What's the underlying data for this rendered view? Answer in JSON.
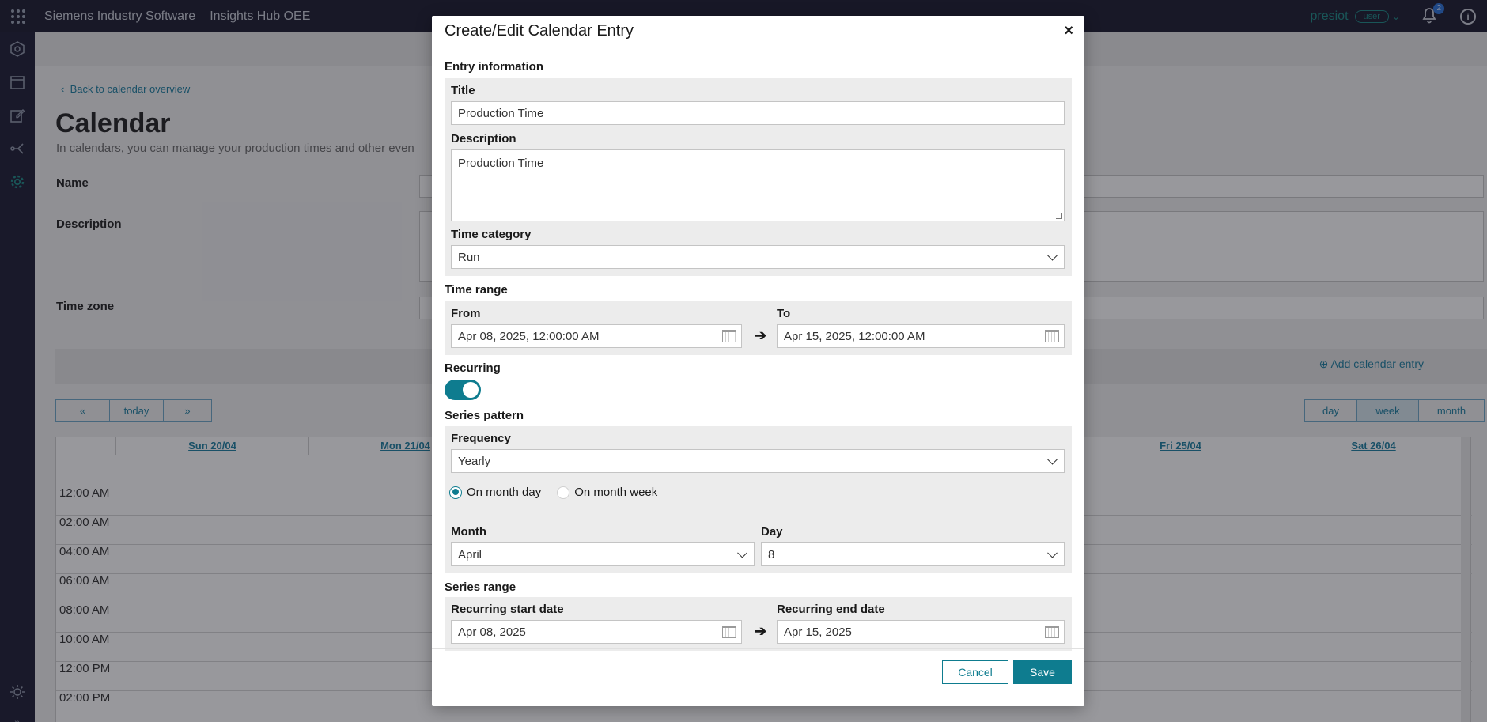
{
  "topbar": {
    "brand": "Siemens Industry Software",
    "app_name": "Insights Hub OEE",
    "tenant": "presiot",
    "user_role": "user",
    "notifications_count": "2",
    "info_symbol": "i"
  },
  "sidenav": {
    "items": [
      "insights-icon",
      "calendar-icon",
      "edit-icon",
      "share-icon",
      "settings-icon",
      "theme-icon",
      "expand-icon"
    ]
  },
  "page": {
    "back_link": "Back to calendar overview",
    "title": "Calendar",
    "subtitle": "In calendars, you can manage your production times and other even",
    "fields": {
      "name_label": "Name",
      "description_label": "Description",
      "timezone_label": "Time zone"
    },
    "add_entry": "Add calendar entry"
  },
  "calendar": {
    "nav": {
      "prev": "«",
      "today": "today",
      "next": "»"
    },
    "views": [
      "day",
      "week",
      "month"
    ],
    "active_view": "week",
    "days": [
      "Sun 20/04",
      "Mon 21/04",
      "Fri 25/04",
      "Sat 26/04"
    ],
    "hours": [
      "12:00 AM",
      "02:00 AM",
      "04:00 AM",
      "06:00 AM",
      "08:00 AM",
      "10:00 AM",
      "12:00 PM",
      "02:00 PM"
    ]
  },
  "modal": {
    "title": "Create/Edit Calendar Entry",
    "close_symbol": "×",
    "entry_info": {
      "section": "Entry information",
      "title_label": "Title",
      "title_value": "Production Time",
      "description_label": "Description",
      "description_value": "Production Time",
      "category_label": "Time category",
      "category_value": "Run"
    },
    "time_range": {
      "section": "Time range",
      "from_label": "From",
      "from_value": "Apr 08, 2025, 12:00:00 AM",
      "to_label": "To",
      "to_value": "Apr 15, 2025, 12:00:00 AM",
      "arrow": "➔"
    },
    "recurring": {
      "label": "Recurring",
      "enabled": true
    },
    "series_pattern": {
      "section": "Series pattern",
      "frequency_label": "Frequency",
      "frequency_value": "Yearly",
      "option_month_day": "On month day",
      "option_month_week": "On month week",
      "selected_option": "On month day",
      "month_label": "Month",
      "month_value": "April",
      "day_label": "Day",
      "day_value": "8"
    },
    "series_range": {
      "section": "Series range",
      "start_label": "Recurring start date",
      "start_value": "Apr 08, 2025",
      "end_label": "Recurring end date",
      "end_value": "Apr 15, 2025",
      "arrow": "➔"
    },
    "buttons": {
      "cancel": "Cancel",
      "save": "Save"
    }
  },
  "colors": {
    "accent": "#0e7c8f",
    "link": "#1e7fa0",
    "topbar": "#1b1b2f"
  }
}
